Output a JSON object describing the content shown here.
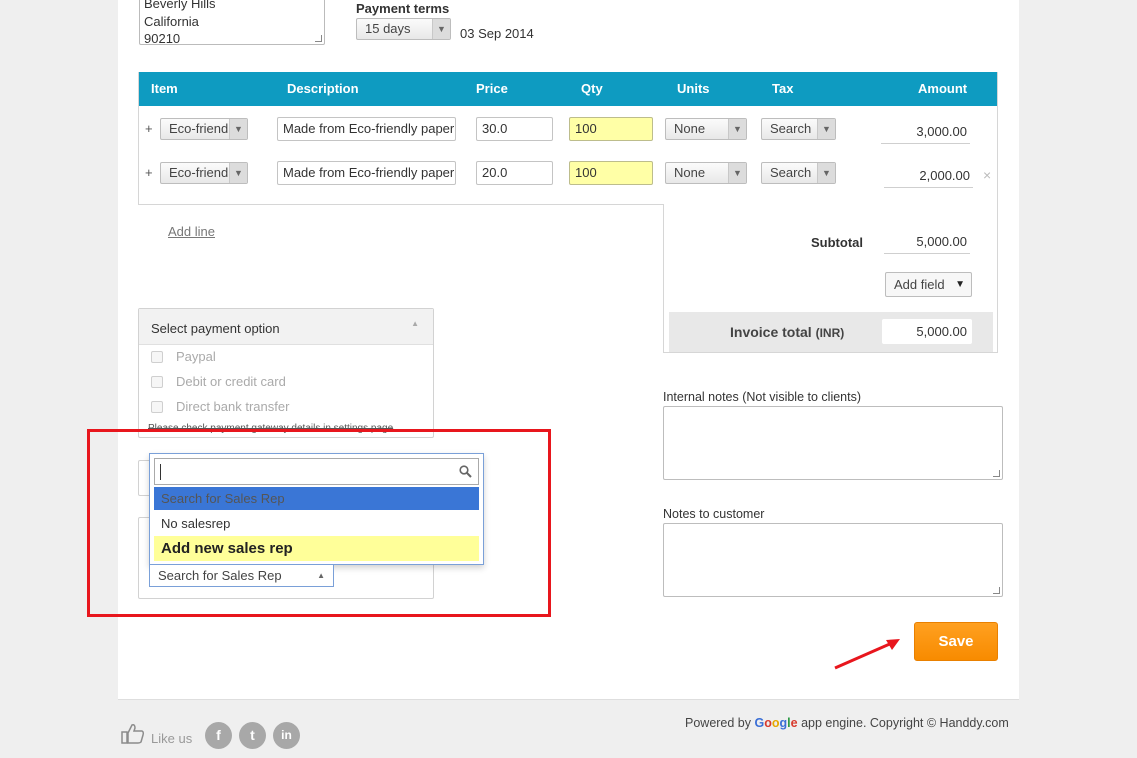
{
  "address": {
    "lines": [
      "Beverly Hills",
      "California",
      "90210"
    ]
  },
  "payment_terms": {
    "label": "Payment terms",
    "selected": "15 days",
    "due_date": "03 Sep 2014"
  },
  "table": {
    "headers": {
      "item": "Item",
      "description": "Description",
      "price": "Price",
      "qty": "Qty",
      "units": "Units",
      "tax": "Tax",
      "amount": "Amount"
    },
    "rows": [
      {
        "plus": "+",
        "item": "Eco-friendly",
        "description": "Made from Eco-friendly paper",
        "price": "30.0",
        "qty": "100",
        "units": "None",
        "tax": "Search",
        "amount": "3,000.00"
      },
      {
        "plus": "+",
        "item": "Eco-friendly",
        "description": "Made from Eco-friendly paper",
        "price": "20.0",
        "qty": "100",
        "units": "None",
        "tax": "Search",
        "amount": "2,000.00",
        "remove": "×"
      }
    ]
  },
  "add_line": "Add line",
  "totals": {
    "subtotal_label": "Subtotal",
    "subtotal_value": "5,000.00",
    "add_field": "Add field",
    "invoice_total_label": "Invoice total",
    "currency": "(INR)",
    "invoice_total_value": "5,000.00"
  },
  "payment_panel": {
    "title": "Select payment option",
    "options": [
      "Paypal",
      "Debit or credit card",
      "Direct bank transfer"
    ],
    "note": "Please check payment gateway details in settings page"
  },
  "salesrep_dropdown": {
    "search_value": "",
    "items": [
      "Search for Sales Rep",
      "No salesrep",
      "Add new sales rep"
    ],
    "selected_label": "Search for Sales Rep"
  },
  "notes": {
    "internal_label": "Internal notes (Not visible to clients)",
    "internal_value": "",
    "customer_label": "Notes to customer",
    "customer_value": ""
  },
  "save_label": "Save",
  "footer": {
    "like_us": "Like us",
    "social": [
      "f",
      "t",
      "in"
    ],
    "powered_by": "Powered by",
    "google": {
      "g1": "G",
      "o1": "o",
      "o2": "o",
      "g2": "g",
      "l": "l",
      "e": "e"
    },
    "after_google": "app engine. Copyright © Handdy.com"
  },
  "colors": {
    "table_header": "#0e9bc1",
    "save": "#f88b00",
    "highlight_red": "#e8161d",
    "qty_yellow": "#ffffa6",
    "selected_blue": "#3a76d6"
  }
}
